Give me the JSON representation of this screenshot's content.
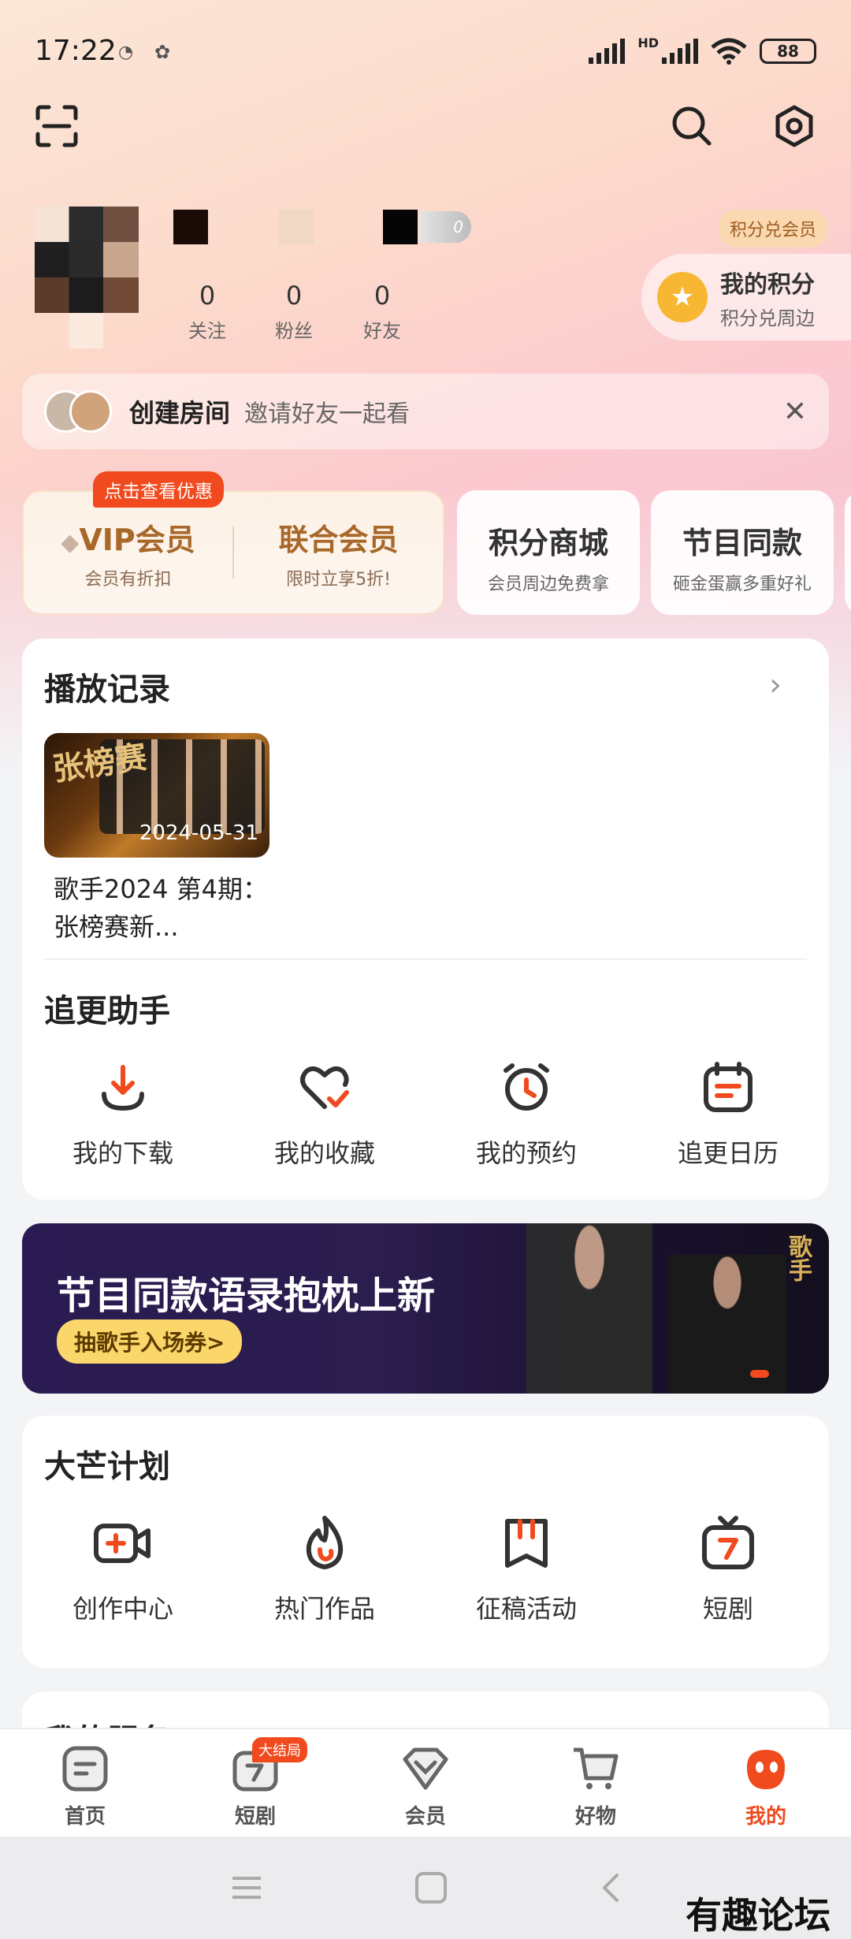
{
  "status_bar": {
    "time": "17:22",
    "network": "HD",
    "battery": "88"
  },
  "profile": {
    "stats": [
      {
        "value": "0",
        "label": "关注"
      },
      {
        "value": "0",
        "label": "粉丝"
      },
      {
        "value": "0",
        "label": "好友"
      }
    ],
    "badge_level": "0"
  },
  "points": {
    "tag": "积分兑会员",
    "title": "我的积分",
    "subtitle": "积分兑周边"
  },
  "room_bar": {
    "title": "创建房间",
    "subtitle": "邀请好友一起看",
    "close": "✕"
  },
  "member_cards": {
    "promo_badge": "点击查看优惠",
    "vip": {
      "title": "VIP会员",
      "subtitle": "会员有折扣"
    },
    "union": {
      "title": "联合会员",
      "subtitle": "限时立享5折!"
    },
    "shop": {
      "title": "积分商城",
      "subtitle": "会员周边免费拿"
    },
    "same": {
      "title": "节目同款",
      "subtitle": "砸金蛋赢多重好礼"
    }
  },
  "history": {
    "title": "播放记录",
    "items": [
      {
        "thumb_text": "张榜赛",
        "date": "2024-05-31",
        "caption": "歌手2024 第4期：张榜赛新..."
      }
    ]
  },
  "assistant": {
    "title": "追更助手",
    "items": [
      {
        "label": "我的下载",
        "icon": "download-icon"
      },
      {
        "label": "我的收藏",
        "icon": "heart-check-icon"
      },
      {
        "label": "我的预约",
        "icon": "alarm-clock-icon"
      },
      {
        "label": "追更日历",
        "icon": "calendar-icon"
      }
    ]
  },
  "banner": {
    "title": "节目同款语录抱枕上新",
    "button": "抽歌手入场券>",
    "logo": "歌手"
  },
  "mango_plan": {
    "title": "大芒计划",
    "items": [
      {
        "label": "创作中心",
        "icon": "video-plus-icon"
      },
      {
        "label": "热门作品",
        "icon": "flame-icon"
      },
      {
        "label": "征稿活动",
        "icon": "bookmark-icon"
      },
      {
        "label": "短剧",
        "icon": "tv-icon"
      }
    ]
  },
  "services": {
    "title": "我的服务"
  },
  "bottom_nav": {
    "items": [
      {
        "label": "首页"
      },
      {
        "label": "短剧",
        "badge": "大结局"
      },
      {
        "label": "会员"
      },
      {
        "label": "好物"
      },
      {
        "label": "我的"
      }
    ]
  },
  "watermark": "有趣论坛",
  "colors": {
    "accent": "#f04a1e",
    "gold": "#a8682a",
    "background": "#f3f4f6"
  }
}
